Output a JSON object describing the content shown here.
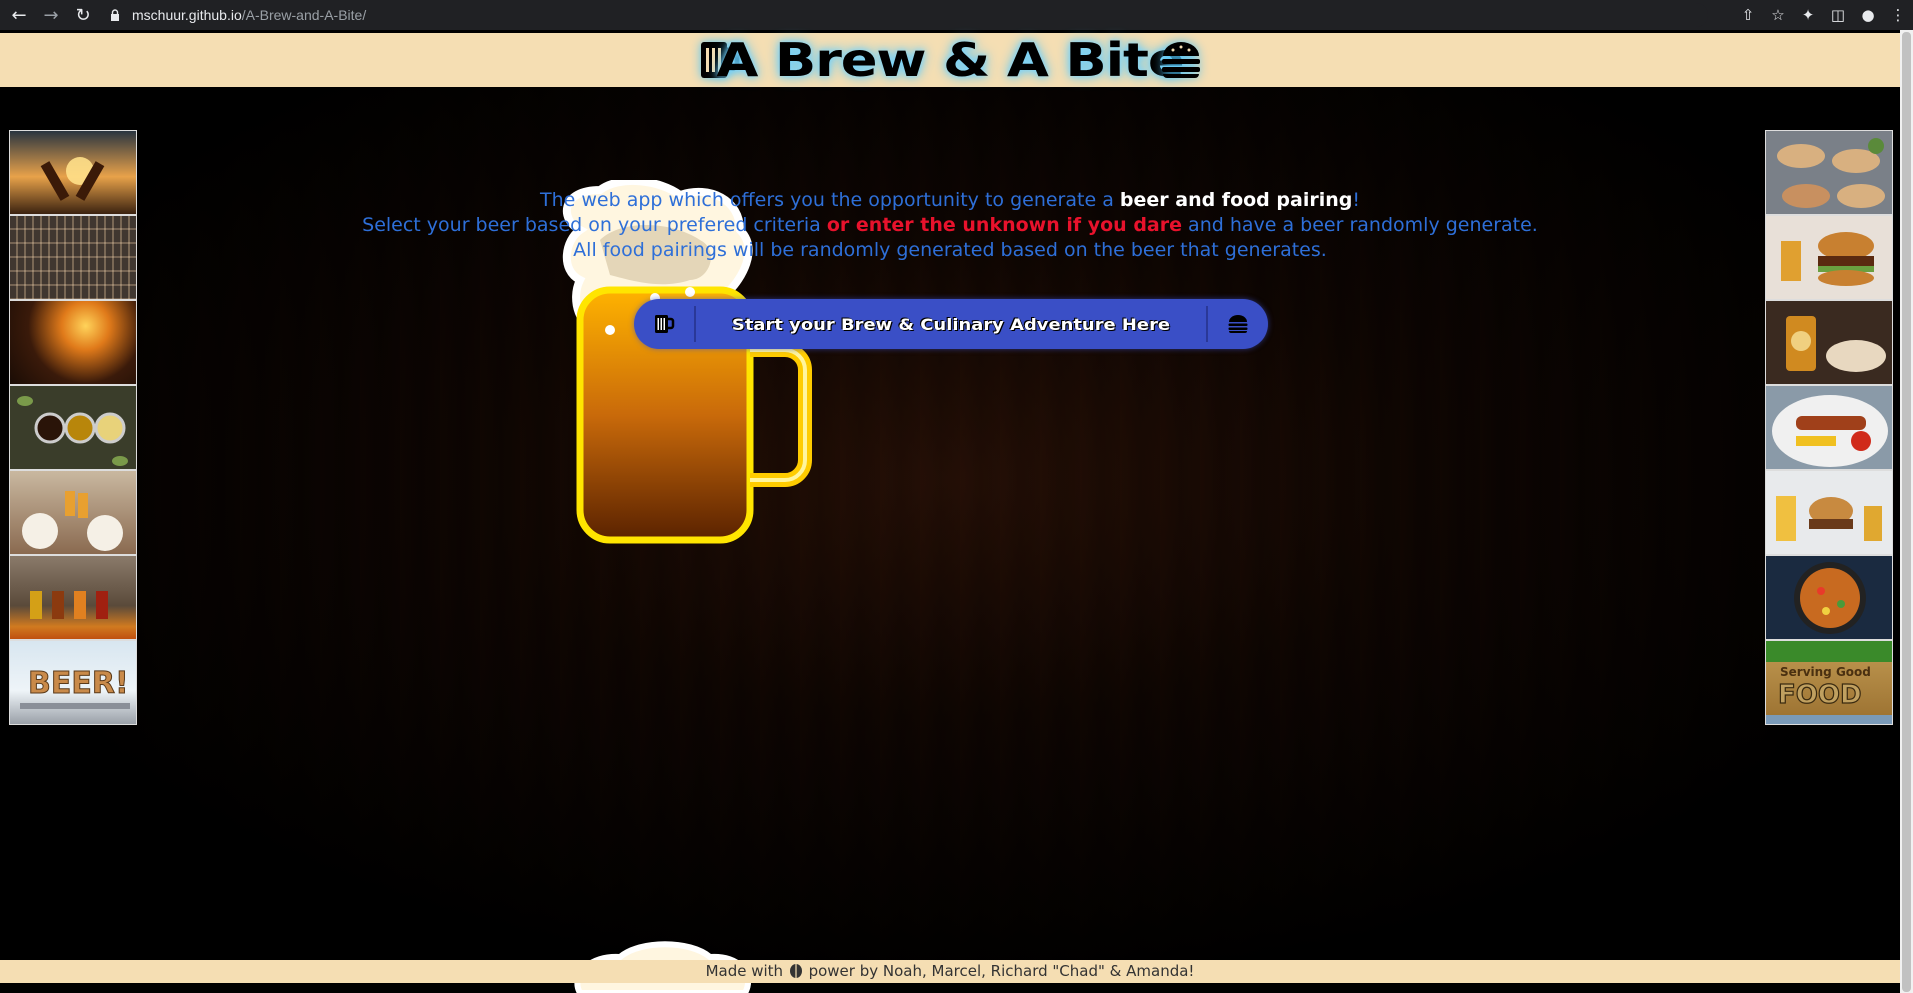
{
  "browser": {
    "url_host": "mschuur.github.io",
    "url_path": "/A-Brew-and-A-Bite/",
    "icons": [
      "back-arrow-icon",
      "forward-arrow-icon",
      "reload-icon",
      "lock-icon",
      "share-icon",
      "star-icon",
      "extensions-icon",
      "sidebar-icon",
      "profile-icon",
      "menu-icon"
    ]
  },
  "header": {
    "title": "A Brew & A Bite",
    "left_icon": "beer-mug-icon",
    "right_icon": "burger-icon",
    "bg_color": "#f5deb3"
  },
  "intro": {
    "line1_a": "The web app which offers you the opportunity to generate a ",
    "line1_b": "beer and food pairing",
    "line1_c": "!",
    "line2_a": "Select your beer based on your prefered criteria ",
    "line2_b": "or enter the unknown if you dare",
    "line2_c": " and have a beer randomly generate.",
    "line3": "All food pairings will be randomly generated based on the beer that generates.",
    "text_color": "#2e6fd8",
    "highlight_color": "#e8122c"
  },
  "start_button": {
    "label": "Start your Brew & Culinary Adventure Here",
    "left_icon": "beer-mug-icon",
    "right_icon": "burger-icon",
    "color": "#3a4fc6"
  },
  "gallery_left": [
    {
      "name": "beer-cheers-sunset-photo"
    },
    {
      "name": "bar-shelves-photo"
    },
    {
      "name": "grill-steak-beer-photo"
    },
    {
      "name": "hops-beer-glasses-photo"
    },
    {
      "name": "friends-toast-meal-photo"
    },
    {
      "name": "beer-flight-photo"
    },
    {
      "name": "beer-sign-photo",
      "text": "BEER!"
    }
  ],
  "gallery_right": [
    {
      "name": "tacos-wraps-photo"
    },
    {
      "name": "burger-fries-photo"
    },
    {
      "name": "beer-and-snacks-photo"
    },
    {
      "name": "grilled-platter-photo"
    },
    {
      "name": "burger-beer-fries-photo"
    },
    {
      "name": "noodle-pan-photo"
    },
    {
      "name": "serving-good-food-sign-photo",
      "text_top": "Serving   Good",
      "text_bottom": "FOOD"
    }
  ],
  "footer": {
    "text_a": "Made with ",
    "text_b": " power by Noah, Marcel, Richard \"Chad\" & Amanda!",
    "icon": "hop-icon"
  }
}
